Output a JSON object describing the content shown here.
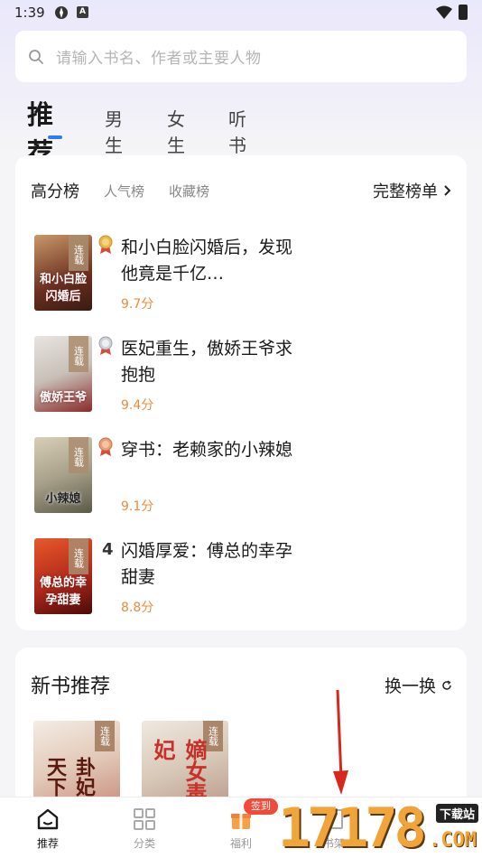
{
  "status_bar": {
    "time": "1:39",
    "icon_a": "A"
  },
  "search": {
    "placeholder": "请输入书名、作者或主要人物"
  },
  "top_tabs": [
    "推荐",
    "男生",
    "女生",
    "听书"
  ],
  "rankings": {
    "tabs": [
      "高分榜",
      "人气榜",
      "收藏榜"
    ],
    "full_list_label": "完整榜单",
    "books": [
      {
        "rank": "1",
        "title": "和小白脸闪婚后，发现他竟是千亿…",
        "score": "9.7分",
        "serial": "连载",
        "cover_text": "和小白脸闪婚后",
        "medal": "gold"
      },
      {
        "rank": "2",
        "title": "医妃重生，傲娇王爷求抱抱",
        "score": "9.4分",
        "serial": "连载",
        "cover_text": "傲娇王爷",
        "medal": "silver"
      },
      {
        "rank": "3",
        "title": "穿书：老赖家的小辣媳",
        "score": "9.1分",
        "serial": "连载",
        "cover_text": "小辣媳",
        "medal": "bronze"
      },
      {
        "rank": "4",
        "title": "闪婚厚爱：傅总的幸孕甜妻",
        "score": "8.8分",
        "serial": "连载",
        "cover_text": "傅总的幸孕甜妻",
        "medal": "none"
      }
    ]
  },
  "new_books": {
    "title": "新书推荐",
    "refresh_label": "换一换",
    "books": [
      {
        "serial": "连载",
        "cover_text": "卦妃天下"
      },
      {
        "serial": "连载",
        "cover_text": "嫡女毒妃"
      }
    ]
  },
  "bottom_nav": {
    "items": [
      "推荐",
      "分类",
      "福利",
      "书架"
    ],
    "sign_badge": "签到"
  },
  "watermark": {
    "digits": "17178",
    "tag": "下载站",
    "suffix": ".COM"
  },
  "colors": {
    "accent": "#2f7cf6",
    "score": "#f08a3c",
    "badge": "#f04a3a"
  }
}
